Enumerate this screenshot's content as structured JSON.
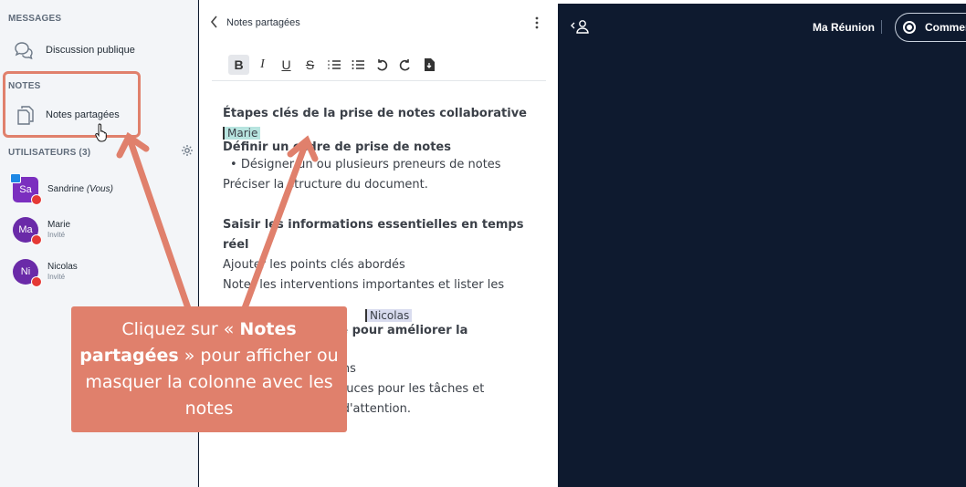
{
  "sidebar": {
    "messages_title": "MESSAGES",
    "public_chat": "Discussion publique",
    "notes_title": "NOTES",
    "shared_notes": "Notes partagées",
    "users_title": "UTILISATEURS (3)",
    "users": [
      {
        "initials": "Sa",
        "name": "Sandrine",
        "suffix": "(Vous)",
        "role": ""
      },
      {
        "initials": "Ma",
        "name": "Marie",
        "suffix": "",
        "role": "Invité"
      },
      {
        "initials": "Ni",
        "name": "Nicolas",
        "suffix": "",
        "role": "Invité"
      }
    ]
  },
  "notes": {
    "title": "Notes partagées",
    "toolbar": [
      "B",
      "I",
      "U",
      "S",
      "ordered-list",
      "bullet-list",
      "undo",
      "redo",
      "export"
    ],
    "doc": {
      "heading1": "Étapes clés de la prise de notes collaborative",
      "cursor_marie": "Marie",
      "heading2": "Définir un cadre de prise de notes",
      "bullet1": "Désigner un ou plusieurs preneurs de notes",
      "line1": "Préciser la structure du document.",
      "heading3": "Saisir les informations essentielles en temps réel",
      "line2": "Ajouter les points clés abordés",
      "line3": "Noter les interventions importantes et lister les",
      "cursor_nicolas": "Nicolas",
      "heading4": "Utiliser le balisage pour améliorer la",
      "line4": "Surligner les décisions",
      "line5": "Utiliser des listes à puces pour les tâches et souligner les points d'attention."
    }
  },
  "callout": {
    "part1": "Cliquez sur « ",
    "bold": "Notes partagées",
    "part2": " »  pour afficher ou masquer la colonne avec les notes"
  },
  "header": {
    "meeting_name": "Ma Réunion",
    "record_label": "Commen"
  },
  "colors": {
    "accent": "#e0806c",
    "dark_bg": "#0e1a2f",
    "avatar_purple": "#6a2aa8"
  }
}
